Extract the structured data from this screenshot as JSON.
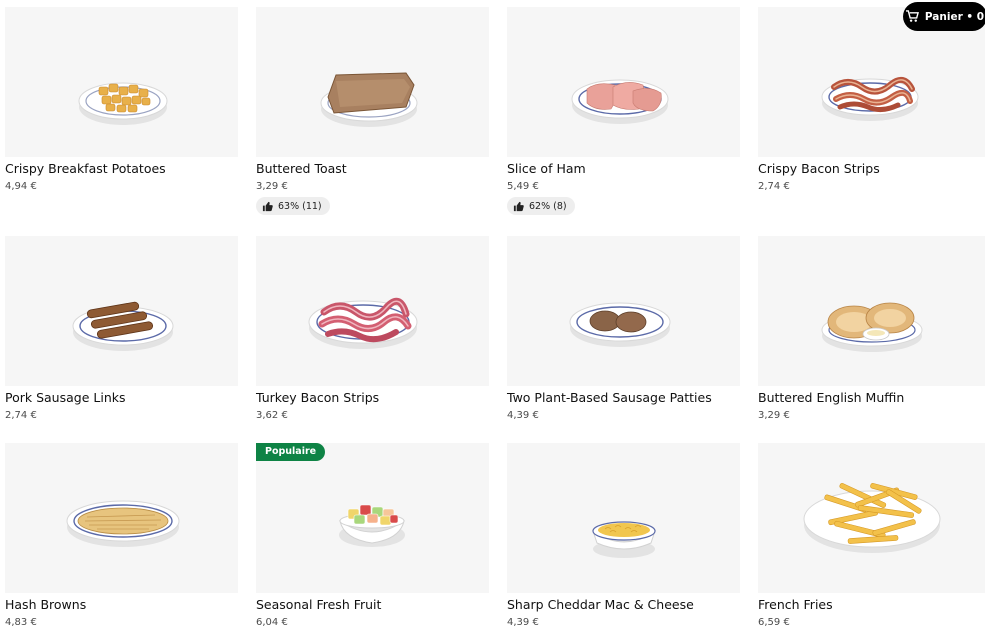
{
  "cart": {
    "label": "Panier • 0"
  },
  "items": [
    {
      "name": "Crispy Breakfast Potatoes",
      "price": "4,94 €"
    },
    {
      "name": "Buttered Toast",
      "price": "3,29 €",
      "rating": "63% (11)"
    },
    {
      "name": "Slice of Ham",
      "price": "5,49 €",
      "rating": "62% (8)"
    },
    {
      "name": "Crispy Bacon Strips",
      "price": "2,74 €"
    },
    {
      "name": "Pork Sausage Links",
      "price": "2,74 €"
    },
    {
      "name": "Turkey Bacon Strips",
      "price": "3,62 €"
    },
    {
      "name": "Two Plant-Based Sausage Patties",
      "price": "4,39 €"
    },
    {
      "name": "Buttered English Muffin",
      "price": "3,29 €"
    },
    {
      "name": "Hash Browns",
      "price": "4,83 €"
    },
    {
      "name": "Seasonal Fresh Fruit",
      "price": "6,04 €",
      "badge": "Populaire"
    },
    {
      "name": "Sharp Cheddar Mac & Cheese",
      "price": "4,39 €"
    },
    {
      "name": "French Fries",
      "price": "6,59 €"
    }
  ],
  "colors": {
    "card_bg": "#f6f6f6",
    "badge_bg": "#0e8345",
    "cart_bg": "#000000",
    "rating_pill": "#eeeeee"
  }
}
